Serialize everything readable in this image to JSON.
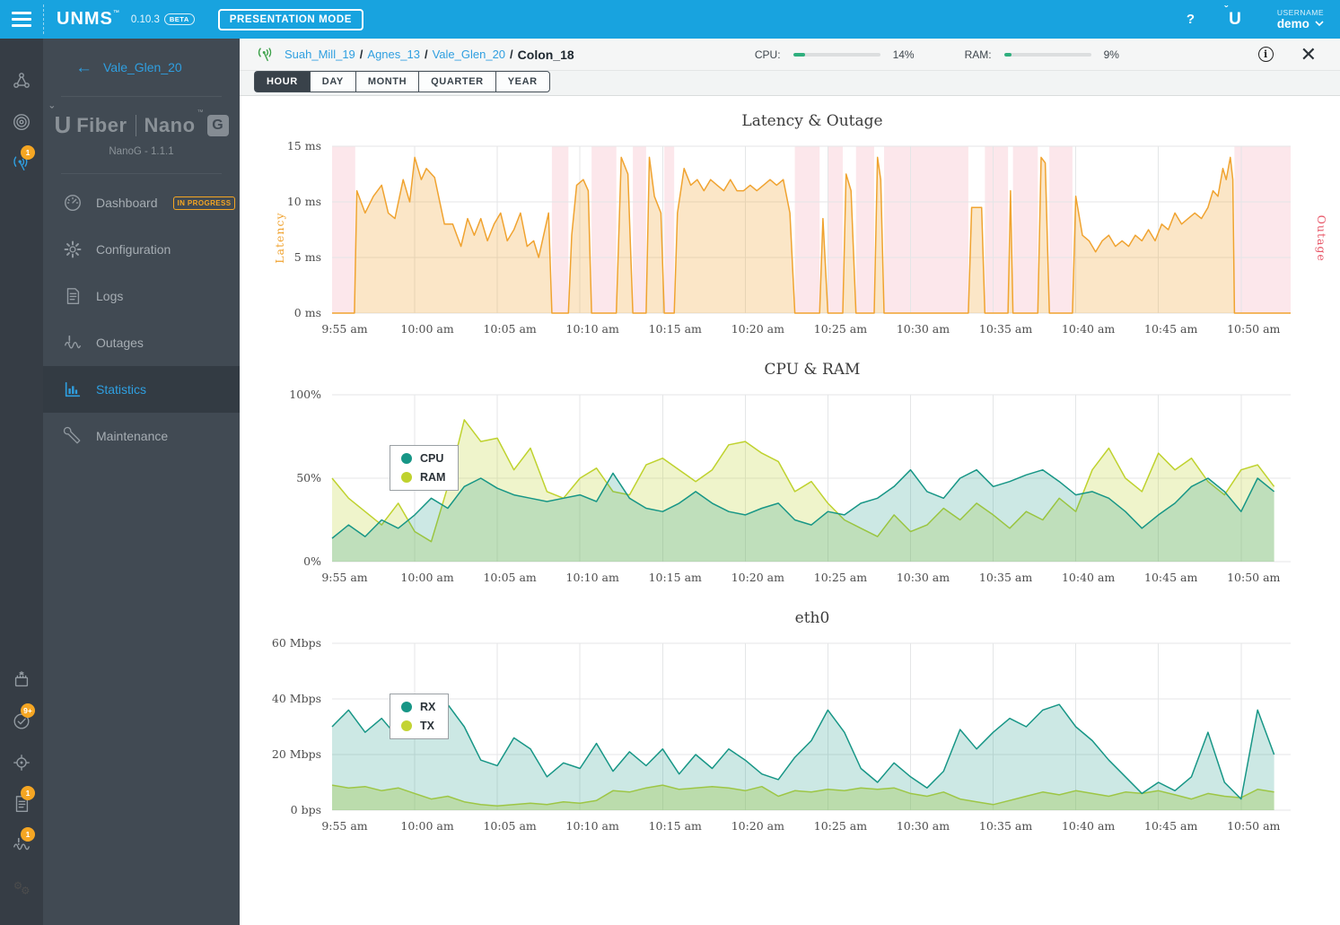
{
  "topbar": {
    "app_name": "UNMS",
    "version": "0.10.3",
    "beta_label": "BETA",
    "presentation_mode_label": "PRESENTATION MODE",
    "help_label": "?",
    "username_label": "USERNAME",
    "username_value": "demo"
  },
  "rail": {
    "top_items": [
      {
        "icon": "sites-icon",
        "badge": ""
      },
      {
        "icon": "devices-icon",
        "badge": ""
      },
      {
        "icon": "antenna-icon",
        "badge": "1",
        "active": true
      }
    ],
    "bottom_items": [
      {
        "icon": "firmware-icon",
        "badge": ""
      },
      {
        "icon": "tasks-check-icon",
        "badge": "9+"
      },
      {
        "icon": "discovery-icon",
        "badge": ""
      },
      {
        "icon": "logs-doc-icon",
        "badge": "1"
      },
      {
        "icon": "outages-pulse-icon",
        "badge": "1"
      },
      {
        "icon": "settings-gears-icon",
        "badge": ""
      }
    ]
  },
  "sidebar": {
    "back_label": "Vale_Glen_20",
    "device": {
      "brand_left": "Fiber",
      "brand_right": "Nano",
      "brand_box": "G",
      "version": "NanoG - 1.1.1"
    },
    "items": [
      {
        "label": "Dashboard",
        "icon": "dashboard-icon",
        "chip": "IN PROGRESS",
        "active": false
      },
      {
        "label": "Configuration",
        "icon": "configuration-icon",
        "chip": "",
        "active": false
      },
      {
        "label": "Logs",
        "icon": "logs-icon",
        "chip": "",
        "active": false
      },
      {
        "label": "Outages",
        "icon": "outages-icon",
        "chip": "",
        "active": false
      },
      {
        "label": "Statistics",
        "icon": "statistics-icon",
        "chip": "",
        "active": true
      },
      {
        "label": "Maintenance",
        "icon": "maintenance-icon",
        "chip": "",
        "active": false
      }
    ]
  },
  "header": {
    "breadcrumb": [
      "Suah_Mill_19",
      "Agnes_13",
      "Vale_Glen_20",
      "Colon_18"
    ],
    "cpu_label": "CPU:",
    "cpu_value": "14%",
    "cpu_percent": 14,
    "ram_label": "RAM:",
    "ram_value": "9%",
    "ram_percent": 9
  },
  "tabs": {
    "labels": [
      "HOUR",
      "DAY",
      "MONTH",
      "QUARTER",
      "YEAR"
    ],
    "active": "HOUR"
  },
  "colors": {
    "topbar_blue": "#18A3DF",
    "link_blue": "#2F9FE0",
    "badge_orange": "#F5A623",
    "gauge_green": "#2FAF7E",
    "latency_orange": "#F0A330",
    "outage_pink": "#E8596A",
    "teal": "#179686",
    "yellow_green": "#BFD22E"
  },
  "chart_data": [
    {
      "type": "area",
      "title": "Latency & Outage",
      "x_tick_labels": [
        "9:55 am",
        "10:00 am",
        "10:05 am",
        "10:10 am",
        "10:15 am",
        "10:20 am",
        "10:25 am",
        "10:30 am",
        "10:35 am",
        "10:40 am",
        "10:45 am",
        "10:50 am"
      ],
      "x_range_minutes": [
        0,
        58
      ],
      "x_tick_interval": 5,
      "y_axis_label": "Latency",
      "right_axis_label": "Outage",
      "ylim": [
        0,
        15
      ],
      "y_tick_labels": [
        "0 ms",
        "5 ms",
        "10 ms",
        "15 ms"
      ],
      "grid": true,
      "series": [
        {
          "name": "Latency",
          "unit": "ms",
          "color": "#F0A330",
          "fill": "rgba(240,163,48,0.27)",
          "points": [
            [
              0,
              0
            ],
            [
              1.35,
              0
            ],
            [
              1.5,
              11
            ],
            [
              2,
              9
            ],
            [
              2.5,
              10.5
            ],
            [
              3,
              11.5
            ],
            [
              3.4,
              9
            ],
            [
              3.8,
              8.5
            ],
            [
              4.3,
              12
            ],
            [
              4.7,
              10
            ],
            [
              5,
              14
            ],
            [
              5.4,
              12
            ],
            [
              5.7,
              13
            ],
            [
              6.2,
              12.2
            ],
            [
              6.8,
              8
            ],
            [
              7.3,
              8
            ],
            [
              7.8,
              6
            ],
            [
              8.2,
              8.5
            ],
            [
              8.6,
              7
            ],
            [
              9,
              8.5
            ],
            [
              9.4,
              6.5
            ],
            [
              9.8,
              8
            ],
            [
              10.2,
              9
            ],
            [
              10.6,
              6.5
            ],
            [
              11,
              7.5
            ],
            [
              11.4,
              9
            ],
            [
              11.8,
              6
            ],
            [
              12.2,
              6.5
            ],
            [
              12.5,
              5
            ],
            [
              12.8,
              7
            ],
            [
              13.1,
              9
            ],
            [
              13.3,
              0
            ],
            [
              14.3,
              0
            ],
            [
              14.5,
              7
            ],
            [
              14.8,
              11.5
            ],
            [
              15.2,
              12
            ],
            [
              15.5,
              11
            ],
            [
              15.7,
              0
            ],
            [
              17.2,
              0
            ],
            [
              17.5,
              14
            ],
            [
              17.9,
              12.5
            ],
            [
              18.2,
              0
            ],
            [
              19,
              0
            ],
            [
              19.2,
              14
            ],
            [
              19.5,
              10.5
            ],
            [
              19.9,
              9
            ],
            [
              20.1,
              0
            ],
            [
              20.7,
              0
            ],
            [
              20.9,
              9
            ],
            [
              21.3,
              13
            ],
            [
              21.7,
              11.5
            ],
            [
              22.1,
              12
            ],
            [
              22.5,
              11
            ],
            [
              22.9,
              12
            ],
            [
              23.3,
              11.5
            ],
            [
              23.7,
              11
            ],
            [
              24.1,
              12
            ],
            [
              24.5,
              11
            ],
            [
              24.9,
              11
            ],
            [
              25.3,
              11.5
            ],
            [
              25.7,
              11
            ],
            [
              26.1,
              11.5
            ],
            [
              26.5,
              12
            ],
            [
              26.9,
              11.5
            ],
            [
              27.3,
              12
            ],
            [
              27.7,
              9
            ],
            [
              28,
              0
            ],
            [
              29.5,
              0
            ],
            [
              29.7,
              8.5
            ],
            [
              30,
              0
            ],
            [
              30.9,
              0
            ],
            [
              31.1,
              12.5
            ],
            [
              31.4,
              11
            ],
            [
              31.7,
              0
            ],
            [
              32.8,
              0
            ],
            [
              33,
              14
            ],
            [
              33.2,
              12
            ],
            [
              33.4,
              0
            ],
            [
              38.5,
              0
            ],
            [
              38.7,
              9.5
            ],
            [
              39.3,
              9.5
            ],
            [
              39.5,
              0
            ],
            [
              40.9,
              0
            ],
            [
              41.05,
              11
            ],
            [
              41.2,
              0
            ],
            [
              42.7,
              0
            ],
            [
              42.9,
              14
            ],
            [
              43.15,
              13.5
            ],
            [
              43.4,
              0
            ],
            [
              44.8,
              0
            ],
            [
              45,
              10.5
            ],
            [
              45.4,
              7
            ],
            [
              45.8,
              6.5
            ],
            [
              46.2,
              5.5
            ],
            [
              46.6,
              6.5
            ],
            [
              47,
              7
            ],
            [
              47.4,
              6
            ],
            [
              47.8,
              6.5
            ],
            [
              48.2,
              6
            ],
            [
              48.6,
              7
            ],
            [
              49,
              6.5
            ],
            [
              49.4,
              7.5
            ],
            [
              49.8,
              6.5
            ],
            [
              50.2,
              8
            ],
            [
              50.6,
              7.5
            ],
            [
              51,
              9
            ],
            [
              51.4,
              8
            ],
            [
              51.8,
              8.5
            ],
            [
              52.2,
              9
            ],
            [
              52.6,
              8.5
            ],
            [
              53,
              9.5
            ],
            [
              53.3,
              11
            ],
            [
              53.6,
              10.5
            ],
            [
              53.9,
              13
            ],
            [
              54.1,
              12
            ],
            [
              54.35,
              14
            ],
            [
              54.5,
              12
            ],
            [
              54.6,
              0
            ],
            [
              58,
              0
            ]
          ]
        }
      ],
      "outage_bands_minutes": [
        [
          0,
          1.4
        ],
        [
          13.3,
          14.3
        ],
        [
          15.7,
          17.2
        ],
        [
          18.2,
          19
        ],
        [
          20.1,
          20.7
        ],
        [
          28,
          29.5
        ],
        [
          30,
          30.9
        ],
        [
          31.7,
          32.8
        ],
        [
          33.4,
          38.5
        ],
        [
          39.5,
          40.9
        ],
        [
          41.2,
          42.7
        ],
        [
          43.4,
          44.8
        ],
        [
          54.6,
          58
        ]
      ],
      "band_fill": "rgba(236,97,119,0.15)"
    },
    {
      "type": "area",
      "title": "CPU & RAM",
      "x_tick_labels": [
        "9:55 am",
        "10:00 am",
        "10:05 am",
        "10:10 am",
        "10:15 am",
        "10:20 am",
        "10:25 am",
        "10:30 am",
        "10:35 am",
        "10:40 am",
        "10:45 am",
        "10:50 am"
      ],
      "x_range_minutes": [
        0,
        58
      ],
      "x_tick_interval": 5,
      "ylim": [
        0,
        100
      ],
      "y_tick_labels": [
        "0%",
        "50%",
        "100%"
      ],
      "grid": true,
      "legend_position": "inside-left",
      "series": [
        {
          "name": "CPU",
          "unit": "%",
          "color": "#179686",
          "fill": "rgba(23,150,134,0.22)",
          "values": [
            14,
            22,
            15,
            25,
            20,
            28,
            38,
            32,
            45,
            50,
            44,
            40,
            38,
            36,
            38,
            40,
            36,
            53,
            38,
            32,
            30,
            35,
            42,
            35,
            30,
            28,
            32,
            35,
            25,
            22,
            30,
            28,
            35,
            38,
            45,
            55,
            42,
            38,
            50,
            55,
            45,
            48,
            52,
            55,
            48,
            40,
            42,
            38,
            30,
            20,
            28,
            35,
            45,
            50,
            42,
            30,
            50,
            42
          ]
        },
        {
          "name": "RAM",
          "unit": "%",
          "color": "#BFD22E",
          "fill": "rgba(191,210,46,0.25)",
          "values": [
            50,
            38,
            30,
            22,
            35,
            18,
            12,
            45,
            85,
            72,
            74,
            55,
            68,
            42,
            38,
            50,
            56,
            42,
            40,
            58,
            62,
            55,
            48,
            55,
            70,
            72,
            65,
            60,
            42,
            48,
            35,
            25,
            20,
            15,
            28,
            18,
            22,
            32,
            25,
            35,
            28,
            20,
            30,
            25,
            38,
            30,
            55,
            68,
            50,
            42,
            65,
            55,
            62,
            48,
            40,
            55,
            58,
            45
          ]
        }
      ]
    },
    {
      "type": "area",
      "title": "eth0",
      "x_tick_labels": [
        "9:55 am",
        "10:00 am",
        "10:05 am",
        "10:10 am",
        "10:15 am",
        "10:20 am",
        "10:25 am",
        "10:30 am",
        "10:35 am",
        "10:40 am",
        "10:45 am",
        "10:50 am"
      ],
      "x_range_minutes": [
        0,
        58
      ],
      "x_tick_interval": 5,
      "ylim": [
        0,
        60
      ],
      "y_tick_labels": [
        "0 bps",
        "20 Mbps",
        "40 Mbps",
        "60 Mbps"
      ],
      "grid": true,
      "legend_position": "inside-left",
      "series": [
        {
          "name": "RX",
          "unit": "Mbps",
          "color": "#179686",
          "fill": "rgba(23,150,134,0.22)",
          "values": [
            30,
            36,
            28,
            33,
            26,
            31,
            39,
            38,
            30,
            18,
            16,
            26,
            22,
            12,
            17,
            15,
            24,
            14,
            21,
            16,
            22,
            13,
            20,
            15,
            22,
            18,
            13,
            11,
            19,
            25,
            36,
            28,
            15,
            10,
            17,
            12,
            8,
            14,
            29,
            22,
            28,
            33,
            30,
            36,
            38,
            30,
            25,
            18,
            12,
            6,
            10,
            7,
            12,
            28,
            10,
            4,
            36,
            20
          ]
        },
        {
          "name": "TX",
          "unit": "Mbps",
          "color": "#C3D434",
          "fill": "rgba(195,212,52,0.35)",
          "values": [
            9,
            8,
            8.5,
            7,
            8,
            6,
            4,
            5,
            3,
            2,
            1.5,
            2,
            2.5,
            2,
            3,
            2.5,
            3.5,
            7,
            6.5,
            8,
            9,
            7.5,
            8,
            8.5,
            8,
            7,
            8.5,
            5,
            7,
            6.5,
            7.5,
            7,
            8,
            7.5,
            8,
            6,
            5,
            6.5,
            4,
            3,
            2,
            3.5,
            5,
            6.5,
            5.5,
            7,
            6,
            5,
            6.5,
            6,
            7,
            5.5,
            4,
            6,
            5,
            4.5,
            7.5,
            6.5
          ]
        }
      ]
    }
  ]
}
